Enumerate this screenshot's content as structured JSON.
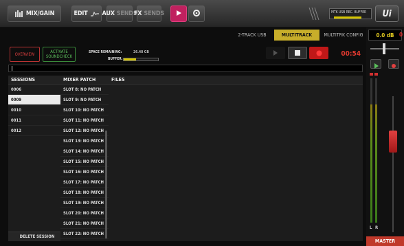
{
  "toolbar": {
    "mix_gain": "MIX/GAIN",
    "edit": "EDIT",
    "aux_label": "AUX",
    "aux_sub": "SENDS",
    "fx_label": "FX",
    "fx_sub": "SENDS",
    "rec_badge": "MTK USB REC. BUFFER",
    "logo": "Ui"
  },
  "tabs": [
    "2-TRACK USB",
    "MULTITRACK",
    "MULTITRK CONFIG"
  ],
  "active_tab": "MULTITRACK",
  "controls": {
    "overview": "OVERVIEW",
    "activate_line1": "ACTIVATE",
    "activate_line2": "SOUNDCHECK",
    "space_label": "SPACE REMAINING:",
    "space_value": "26.48 GB",
    "buffer_label": "BUFFER:",
    "buffer_level": 0.35,
    "timer": "00:54"
  },
  "columns": {
    "sessions": "SESSIONS",
    "mixer_patch": "MIXER PATCH",
    "files": "FILES"
  },
  "sessions": [
    "0006",
    "0009",
    "0010",
    "0011",
    "0012"
  ],
  "selected_session": "0009",
  "patches": [
    "SLOT 8: NO PATCH",
    "SLOT 9: NO PATCH",
    "SLOT 10: NO PATCH",
    "SLOT 11: NO PATCH",
    "SLOT 12: NO PATCH",
    "SLOT 13: NO PATCH",
    "SLOT 14: NO PATCH",
    "SLOT 15: NO PATCH",
    "SLOT 16: NO PATCH",
    "SLOT 17: NO PATCH",
    "SLOT 18: NO PATCH",
    "SLOT 19: NO PATCH",
    "SLOT 20: NO PATCH",
    "SLOT 21: NO PATCH",
    "SLOT 22: NO PATCH"
  ],
  "delete_session": "DELETE SESSION",
  "right": {
    "level": "0.0 dB",
    "meter_l": "L",
    "meter_r": "R",
    "master": "MASTER"
  },
  "colors": {
    "accent_yellow": "#c8ae2a",
    "record_red": "#e0392f",
    "master_red": "#c0392b",
    "play_pink": "#c0215f",
    "activate_green": "#3a8a3a"
  }
}
